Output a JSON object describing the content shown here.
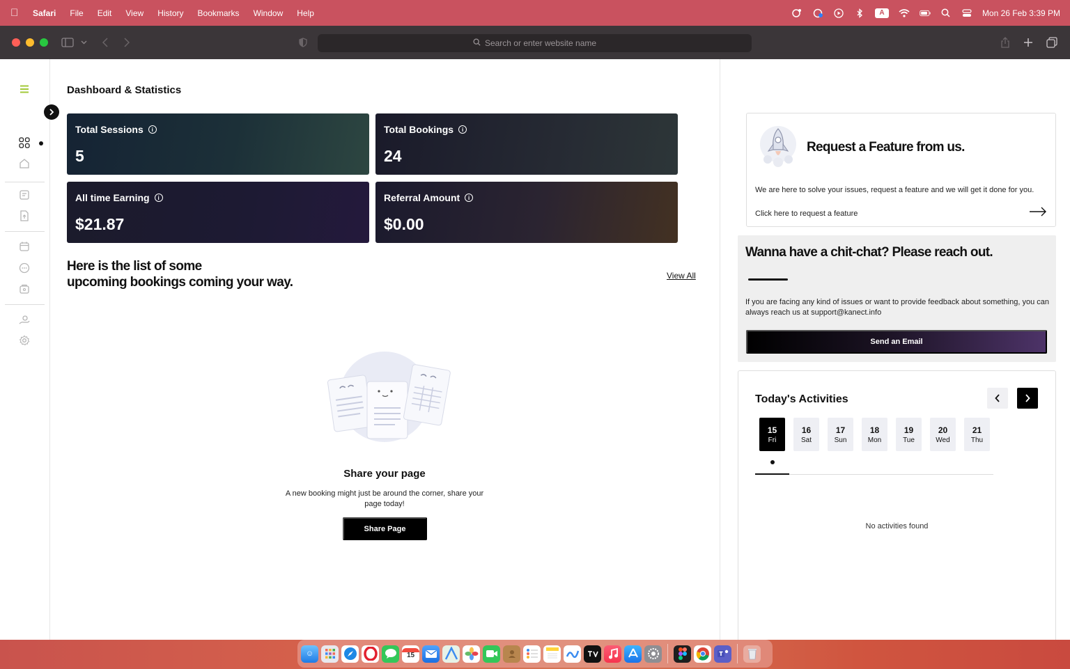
{
  "menubar": {
    "app_name": "Safari",
    "items": [
      "File",
      "Edit",
      "View",
      "History",
      "Bookmarks",
      "Window",
      "Help"
    ],
    "input_badge": "A",
    "datetime": "Mon 26 Feb  3:39 PM"
  },
  "browser": {
    "address_placeholder": "Search or enter website name"
  },
  "main": {
    "page_title": "Dashboard & Statistics",
    "stats": [
      {
        "label": "Total Sessions",
        "value": "5"
      },
      {
        "label": "Total Bookings",
        "value": "24"
      },
      {
        "label": "All time Earning",
        "value": "$21.87"
      },
      {
        "label": "Referral Amount",
        "value": "$0.00"
      }
    ],
    "list_heading_line1": "Here is the list of some",
    "list_heading_line2": "upcoming bookings coming your way",
    "view_all": "View All",
    "empty_title": "Share your page",
    "empty_desc": "A new booking might just be around the corner, share your page today!",
    "share_button": "Share Page"
  },
  "feature": {
    "title": "Request a Feature from us",
    "desc": "We are here to solve your issues, request a feature and we will get it done for you.",
    "link": "Click here to request a feature"
  },
  "chat": {
    "title": "Wanna have a chit-chat? Please reach out.",
    "desc": "If you are facing any kind of issues or want to provide feedback about something, you can always reach us at support@kanect.info",
    "button": "Send an Email"
  },
  "activities": {
    "title": "Today's Activities",
    "days": [
      {
        "num": "15",
        "dow": "Fri",
        "active": true
      },
      {
        "num": "16",
        "dow": "Sat"
      },
      {
        "num": "17",
        "dow": "Sun"
      },
      {
        "num": "18",
        "dow": "Mon"
      },
      {
        "num": "19",
        "dow": "Tue"
      },
      {
        "num": "20",
        "dow": "Wed"
      },
      {
        "num": "21",
        "dow": "Thu"
      }
    ],
    "empty": "No activities found"
  },
  "dock": {
    "calendar_day": "15"
  },
  "colors": {
    "menubar": "#c9525f",
    "toolbar": "#3b3639",
    "accent_menu_icon": "#a3c93a",
    "button_dark": "#000000"
  }
}
